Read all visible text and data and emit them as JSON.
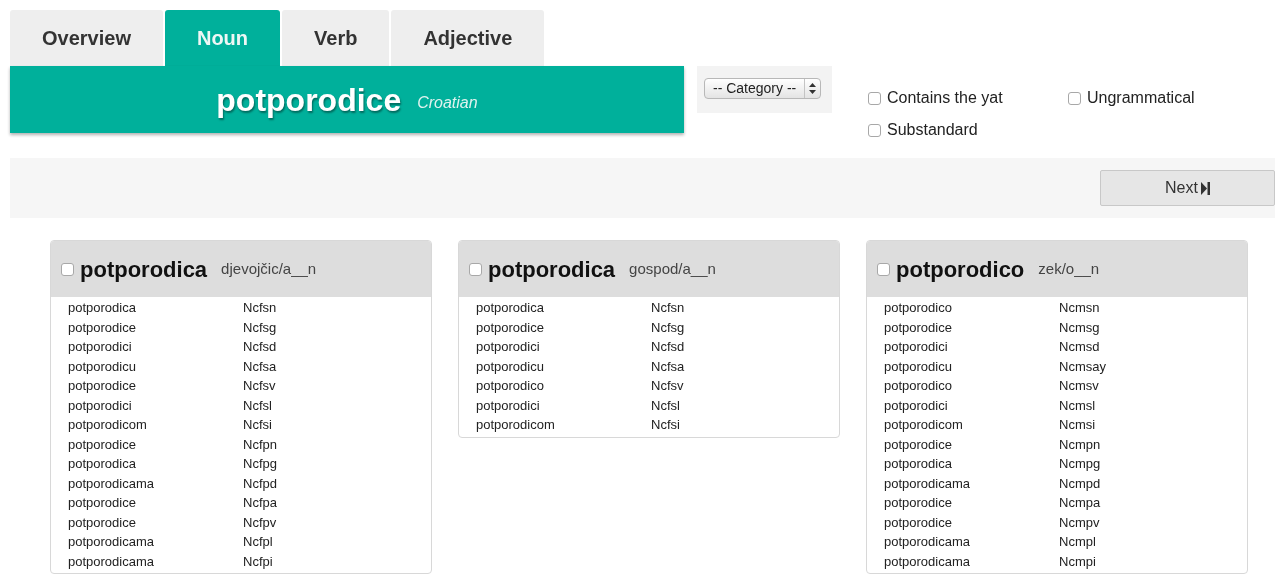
{
  "tabs": [
    {
      "label": "Overview",
      "selected": false
    },
    {
      "label": "Noun",
      "selected": true
    },
    {
      "label": "Verb",
      "selected": false
    },
    {
      "label": "Adjective",
      "selected": false
    }
  ],
  "header": {
    "word": "potporodice",
    "language": "Croatian"
  },
  "category_select": {
    "value": "-- Category --"
  },
  "filters": [
    {
      "label": "Contains the yat",
      "checked": false
    },
    {
      "label": "Ungrammatical",
      "checked": false
    },
    {
      "label": "Substandard",
      "checked": false
    }
  ],
  "next_button": {
    "label": "Next"
  },
  "paradigms": [
    {
      "lemma": "potporodica",
      "pattern": "djevojčic/a__n",
      "checked": false,
      "rows": [
        {
          "form": "potporodica",
          "tag": "Ncfsn"
        },
        {
          "form": "potporodice",
          "tag": "Ncfsg"
        },
        {
          "form": "potporodici",
          "tag": "Ncfsd"
        },
        {
          "form": "potporodicu",
          "tag": "Ncfsa"
        },
        {
          "form": "potporodice",
          "tag": "Ncfsv"
        },
        {
          "form": "potporodici",
          "tag": "Ncfsl"
        },
        {
          "form": "potporodicom",
          "tag": "Ncfsi"
        },
        {
          "form": "potporodice",
          "tag": "Ncfpn"
        },
        {
          "form": "potporodica",
          "tag": "Ncfpg"
        },
        {
          "form": "potporodicama",
          "tag": "Ncfpd"
        },
        {
          "form": "potporodice",
          "tag": "Ncfpa"
        },
        {
          "form": "potporodice",
          "tag": "Ncfpv"
        },
        {
          "form": "potporodicama",
          "tag": "Ncfpl"
        },
        {
          "form": "potporodicama",
          "tag": "Ncfpi"
        }
      ]
    },
    {
      "lemma": "potporodica",
      "pattern": "gospod/a__n",
      "checked": false,
      "rows": [
        {
          "form": "potporodica",
          "tag": "Ncfsn"
        },
        {
          "form": "potporodice",
          "tag": "Ncfsg"
        },
        {
          "form": "potporodici",
          "tag": "Ncfsd"
        },
        {
          "form": "potporodicu",
          "tag": "Ncfsa"
        },
        {
          "form": "potporodico",
          "tag": "Ncfsv"
        },
        {
          "form": "potporodici",
          "tag": "Ncfsl"
        },
        {
          "form": "potporodicom",
          "tag": "Ncfsi"
        }
      ]
    },
    {
      "lemma": "potporodico",
      "pattern": "zek/o__n",
      "checked": false,
      "rows": [
        {
          "form": "potporodico",
          "tag": "Ncmsn"
        },
        {
          "form": "potporodice",
          "tag": "Ncmsg"
        },
        {
          "form": "potporodici",
          "tag": "Ncmsd"
        },
        {
          "form": "potporodicu",
          "tag": "Ncmsay"
        },
        {
          "form": "potporodico",
          "tag": "Ncmsv"
        },
        {
          "form": "potporodici",
          "tag": "Ncmsl"
        },
        {
          "form": "potporodicom",
          "tag": "Ncmsi"
        },
        {
          "form": "potporodice",
          "tag": "Ncmpn"
        },
        {
          "form": "potporodica",
          "tag": "Ncmpg"
        },
        {
          "form": "potporodicama",
          "tag": "Ncmpd"
        },
        {
          "form": "potporodice",
          "tag": "Ncmpa"
        },
        {
          "form": "potporodice",
          "tag": "Ncmpv"
        },
        {
          "form": "potporodicama",
          "tag": "Ncmpl"
        },
        {
          "form": "potporodicama",
          "tag": "Ncmpi"
        }
      ]
    }
  ]
}
